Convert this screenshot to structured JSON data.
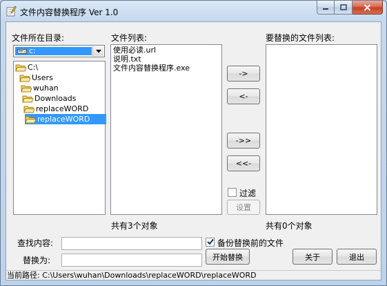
{
  "window": {
    "title": "文件内容替换程序 Ver 1.0"
  },
  "labels": {
    "directory": "文件所在目录:",
    "file_list": "文件列表:",
    "replace_list": "要替换的文件列表:",
    "file_count": "共有3个对象",
    "replace_count": "共有0个对象",
    "find": "查找内容:",
    "replace": "替换为:",
    "filter": "过滤",
    "backup": "备份替换前的文件"
  },
  "drive": {
    "selected": "c:"
  },
  "tree": [
    {
      "label": "C:\\"
    },
    {
      "label": "Users"
    },
    {
      "label": "wuhan"
    },
    {
      "label": "Downloads"
    },
    {
      "label": "replaceWORD"
    },
    {
      "label": "replaceWORD"
    }
  ],
  "files": [
    "使用必读.url",
    "说明.txt",
    "文件内容替换程序.exe"
  ],
  "buttons": {
    "add": "->",
    "remove": "<-",
    "add_all": "->>",
    "remove_all": "<<-",
    "settings": "设置",
    "start": "开始替换",
    "about": "关于",
    "exit": "退出"
  },
  "inputs": {
    "find_value": "",
    "replace_value": ""
  },
  "checks": {
    "filter": false,
    "backup": true
  },
  "status": {
    "path": "当前路径: C:\\Users\\wuhan\\Downloads\\replaceWORD\\replaceWORD"
  }
}
